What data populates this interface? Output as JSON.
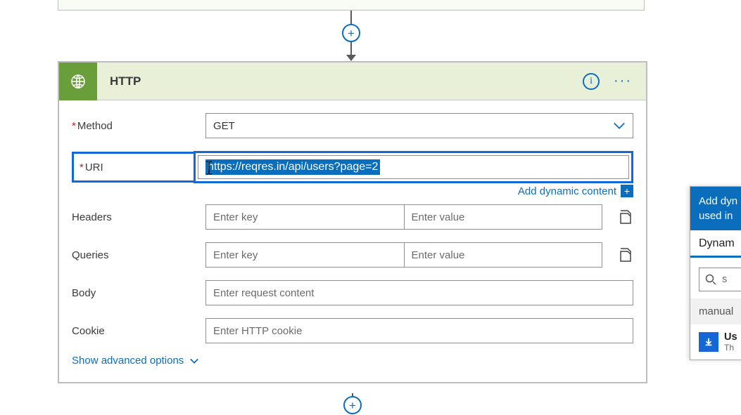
{
  "action": {
    "title": "HTTP",
    "method": {
      "label": "Method",
      "value": "GET"
    },
    "uri": {
      "label": "URI",
      "value": "https://reqres.in/api/users?page=2"
    },
    "dynamic_link": "Add dynamic content",
    "headers": {
      "label": "Headers",
      "key_placeholder": "Enter key",
      "value_placeholder": "Enter value"
    },
    "queries": {
      "label": "Queries",
      "key_placeholder": "Enter key",
      "value_placeholder": "Enter value"
    },
    "body": {
      "label": "Body",
      "placeholder": "Enter request content"
    },
    "cookie": {
      "label": "Cookie",
      "placeholder": "Enter HTTP cookie"
    },
    "advanced": "Show advanced options"
  },
  "panel": {
    "heading_line1": "Add dyn",
    "heading_line2": "used in",
    "tab": "Dynam",
    "search_placeholder": "s",
    "section": "manual",
    "item": {
      "label": "Us",
      "sub": "Th"
    }
  }
}
